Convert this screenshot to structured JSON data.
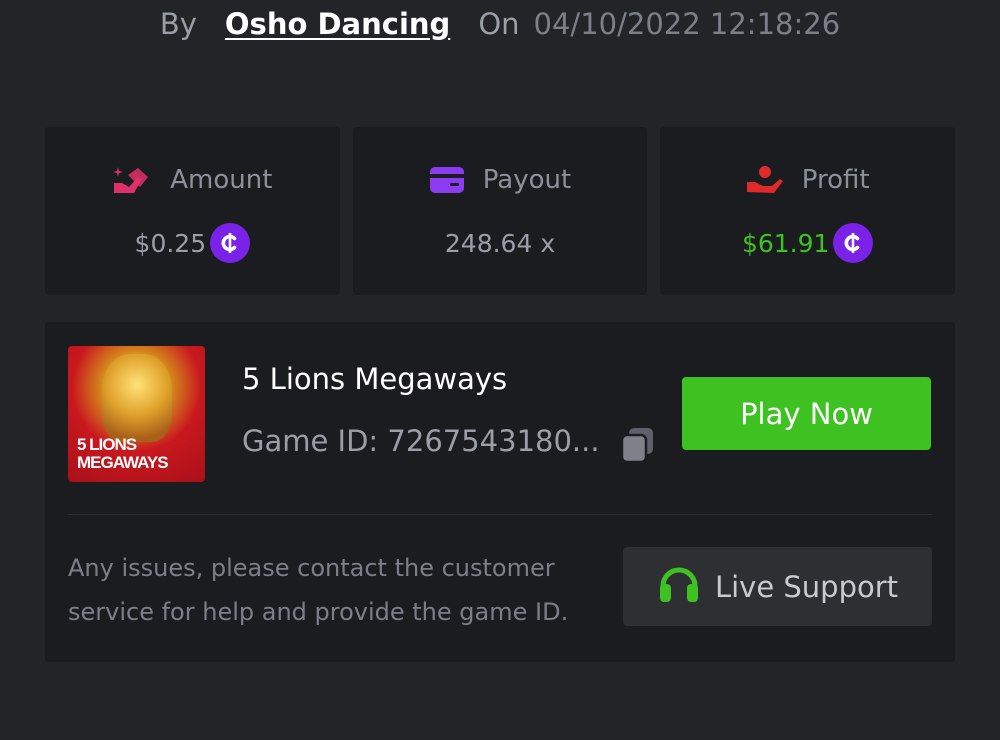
{
  "byline": {
    "by_label": "By",
    "author": "Osho Dancing",
    "on_label": "On",
    "datetime": "04/10/2022 12:18:26"
  },
  "stats": {
    "amount": {
      "label": "Amount",
      "value": "$0.25",
      "icon": "hand-coin-icon",
      "currency_icon": "coin-icon"
    },
    "payout": {
      "label": "Payout",
      "value": "248.64 x",
      "icon": "card-icon"
    },
    "profit": {
      "label": "Profit",
      "value": "$61.91",
      "icon": "hand-heart-icon",
      "currency_icon": "coin-icon"
    }
  },
  "game": {
    "title": "5 Lions Megaways",
    "id_text": "Game ID: 7267543180...",
    "thumbnail_text": "5 LIONS MEGAWAYS",
    "play_label": "Play Now"
  },
  "support": {
    "help_text": "Any issues, please contact the customer service for help and provide the game ID.",
    "button_label": "Live Support",
    "icon": "headset-icon"
  },
  "colors": {
    "background": "#232427",
    "panel": "#1b1c1f",
    "accent_green": "#3dc221",
    "coin_purple": "#7b22e8",
    "amount_pink": "#e0306a",
    "payout_purple": "#8b3cf0",
    "profit_red": "#e02a2a"
  }
}
